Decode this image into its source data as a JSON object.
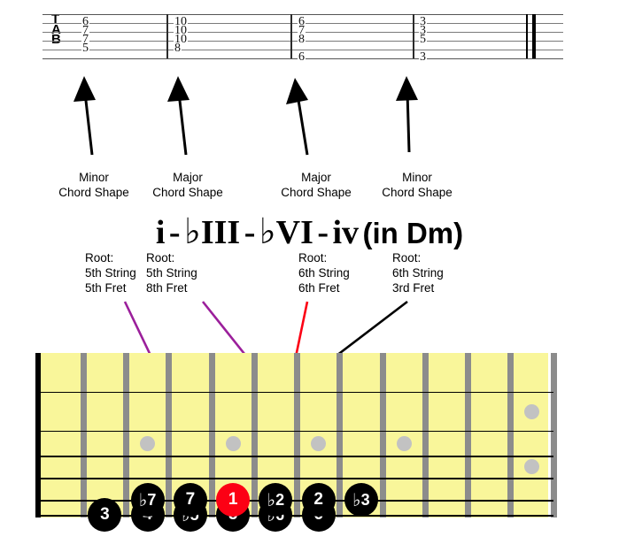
{
  "tab": {
    "clef_letters": [
      "T",
      "A",
      "B"
    ],
    "measures": [
      {
        "name": "measure-1",
        "numbers": [
          {
            "string": 2,
            "fret": "6"
          },
          {
            "string": 3,
            "fret": "7"
          },
          {
            "string": 4,
            "fret": "7"
          },
          {
            "string": 5,
            "fret": "5"
          }
        ]
      },
      {
        "name": "measure-2",
        "numbers": [
          {
            "string": 2,
            "fret": "10"
          },
          {
            "string": 3,
            "fret": "10"
          },
          {
            "string": 4,
            "fret": "10"
          },
          {
            "string": 5,
            "fret": "8"
          }
        ]
      },
      {
        "name": "measure-3",
        "numbers": [
          {
            "string": 2,
            "fret": "6"
          },
          {
            "string": 3,
            "fret": "7"
          },
          {
            "string": 4,
            "fret": "8"
          },
          {
            "string": 6,
            "fret": "6"
          }
        ]
      },
      {
        "name": "measure-4",
        "numbers": [
          {
            "string": 2,
            "fret": "3"
          },
          {
            "string": 3,
            "fret": "3"
          },
          {
            "string": 4,
            "fret": "5"
          },
          {
            "string": 6,
            "fret": "3"
          }
        ]
      }
    ]
  },
  "shape_labels": [
    {
      "line1": "Minor",
      "line2": "Chord Shape"
    },
    {
      "line1": "Major",
      "line2": "Chord Shape"
    },
    {
      "line1": "Major",
      "line2": "Chord Shape"
    },
    {
      "line1": "Minor",
      "line2": "Chord Shape"
    }
  ],
  "progression": {
    "chord1": "i",
    "dash1": "-",
    "flat1": "♭",
    "chord2": "III",
    "dash2": "-",
    "flat2": "♭",
    "chord3": "VI",
    "dash3": "-",
    "chord4": "iv",
    "key": "(in Dm)"
  },
  "roots": [
    {
      "label": "Root:",
      "string": "5th String",
      "fret": "5th Fret"
    },
    {
      "label": "Root:",
      "string": "5th String",
      "fret": "8th Fret"
    },
    {
      "label": "Root:",
      "string": "6th String",
      "fret": "6th Fret"
    },
    {
      "label": "Root:",
      "string": "6th String",
      "fret": "3rd Fret"
    }
  ],
  "fretboard": {
    "fret_count": 12,
    "string_count": 6,
    "inlay_frets": [
      3,
      5,
      7,
      9,
      12
    ],
    "notes": [
      {
        "degree": "3",
        "flat": "",
        "string": 6,
        "fret": 2,
        "root": false
      },
      {
        "degree": "4",
        "flat": "",
        "string": 6,
        "fret": 3,
        "root": false
      },
      {
        "degree": "5",
        "flat": "♭",
        "string": 6,
        "fret": 4,
        "root": false
      },
      {
        "degree": "5",
        "flat": "",
        "string": 6,
        "fret": 5,
        "root": false
      },
      {
        "degree": "6",
        "flat": "♭",
        "string": 6,
        "fret": 6,
        "root": false
      },
      {
        "degree": "6",
        "flat": "",
        "string": 6,
        "fret": 7,
        "root": false
      },
      {
        "degree": "7",
        "flat": "♭",
        "string": 5,
        "fret": 3,
        "root": false
      },
      {
        "degree": "7",
        "flat": "",
        "string": 5,
        "fret": 4,
        "root": false
      },
      {
        "degree": "1",
        "flat": "",
        "string": 5,
        "fret": 5,
        "root": true
      },
      {
        "degree": "2",
        "flat": "♭",
        "string": 5,
        "fret": 6,
        "root": false
      },
      {
        "degree": "2",
        "flat": "",
        "string": 5,
        "fret": 7,
        "root": false
      },
      {
        "degree": "3",
        "flat": "♭",
        "string": 5,
        "fret": 8,
        "root": false
      }
    ]
  },
  "colors": {
    "fretboard": "#f9f69a",
    "fretwire": "#8c8c8c",
    "inlay": "#c2c2c2",
    "note": "#000000",
    "root_note": "#fc0014",
    "arrow_purple": "#9b1f9b",
    "arrow_red": "#fc0014",
    "arrow_black": "#000000"
  },
  "pointer_arrows": [
    {
      "name": "arrow-to-root-1",
      "color": "#9b1f9b"
    },
    {
      "name": "arrow-to-flat3",
      "color": "#9b1f9b"
    },
    {
      "name": "arrow-to-flat6",
      "color": "#fc0014"
    },
    {
      "name": "arrow-to-4",
      "color": "#000000"
    }
  ]
}
